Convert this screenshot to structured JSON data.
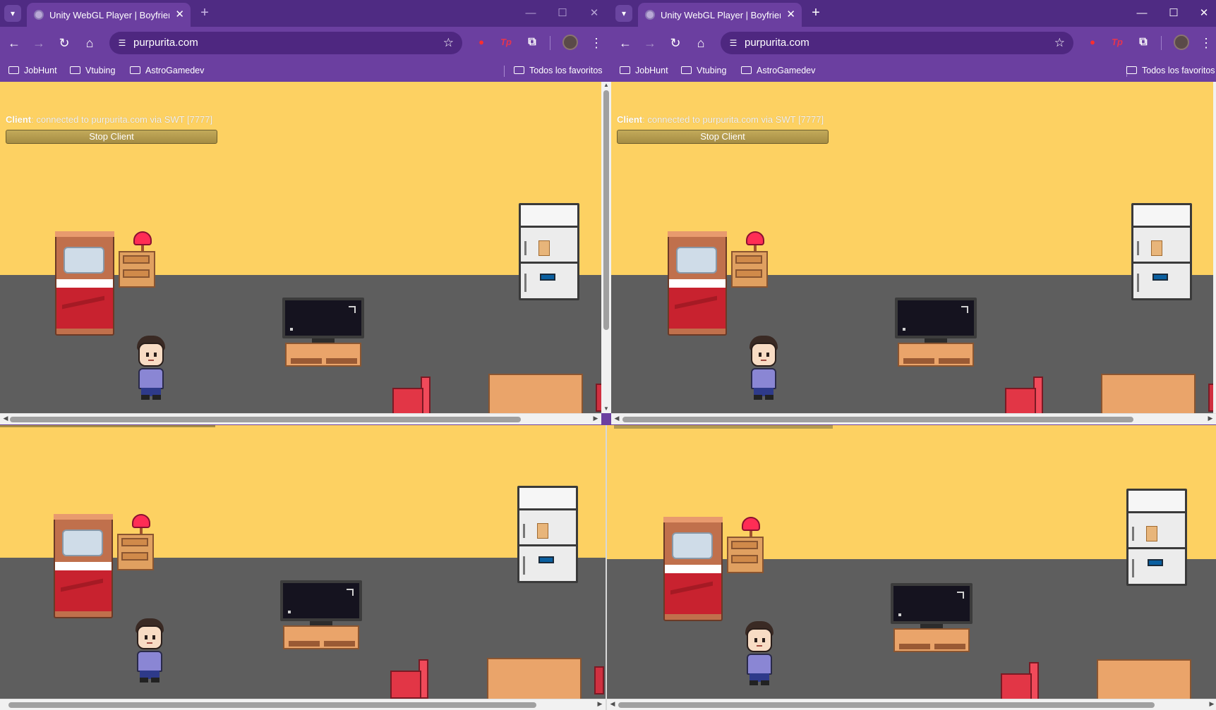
{
  "windows": [
    {
      "tab_title": "Unity WebGL Player | Boyfriend",
      "url": "purpurita.com",
      "bookmarks": [
        "JobHunt",
        "Vtubing",
        "AstroGamedev"
      ],
      "all_bookmarks": "Todos los favoritos"
    },
    {
      "tab_title": "Unity WebGL Player | Boyfriend",
      "url": "purpurita.com",
      "bookmarks": [
        "JobHunt",
        "Vtubing",
        "AstroGamedev"
      ],
      "all_bookmarks": "Todos los favoritos"
    }
  ],
  "hud": {
    "client_label": "Client",
    "client_status": ": connected to purpurita.com via SWT [7777]",
    "stop_button": "Stop Client"
  },
  "icons": {
    "tab_menu": "chevron-down-icon",
    "back": "arrow-left-icon",
    "forward": "arrow-right-icon",
    "reload": "reload-icon",
    "home": "home-icon",
    "bookmark": "star-icon",
    "extensions": "puzzle-icon",
    "folder": "folder-icon"
  },
  "colors": {
    "chrome_purple": "#6b3fa0",
    "titlebar_purple": "#4f2b83",
    "wall_yellow": "#fdd162",
    "floor_gray": "#5e5e5e",
    "button_gold": "#b39a4e"
  }
}
